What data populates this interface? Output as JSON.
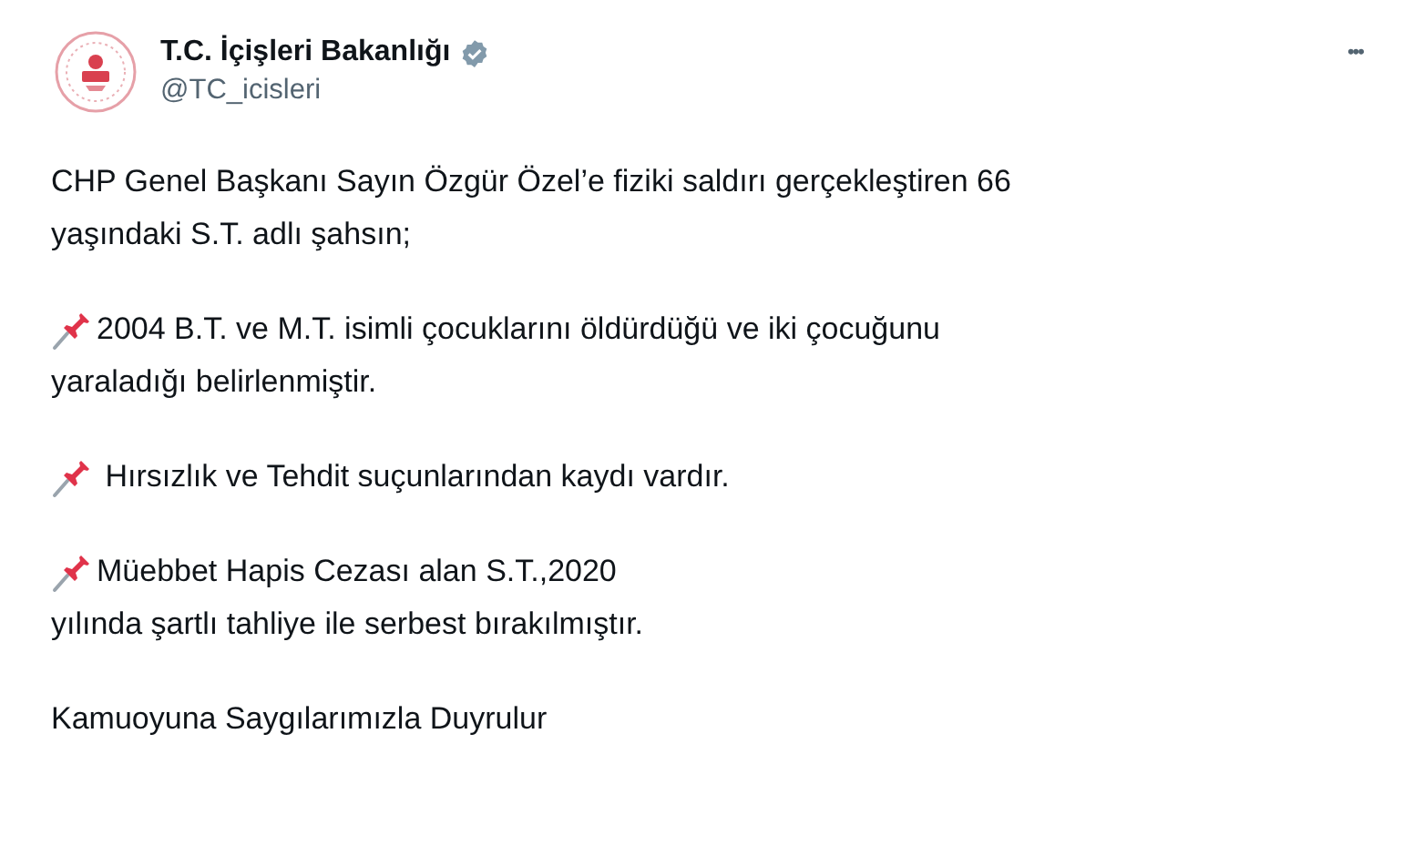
{
  "author": {
    "name": "T.C. İçişleri Bakanlığı",
    "verified": true,
    "handle": "@TC_icisleri"
  },
  "more_button": "•••",
  "paragraphs": [
    {
      "kind": "plain",
      "lines": [
        "CHP Genel Başkanı Sayın Özgür Özel’e fiziki saldırı gerçekleştiren 66",
        "yaşındaki S.T. adlı şahsın;"
      ]
    },
    {
      "kind": "pinned",
      "lines": [
        "2004 B.T. ve M.T. isimli çocuklarını öldürdüğü ve iki çocuğunu",
        "yaraladığı belirlenmiştir."
      ]
    },
    {
      "kind": "pinned",
      "lines": [
        " Hırsızlık ve Tehdit suçunlarından kaydı vardır."
      ]
    },
    {
      "kind": "pinned",
      "lines": [
        "Müebbet Hapis Cezası alan S.T.,2020",
        "yılında şartlı tahliye ile serbest bırakılmıştır."
      ]
    },
    {
      "kind": "plain",
      "lines": [
        "Kamuoyuna Saygılarımızla Duyrulur"
      ]
    }
  ]
}
